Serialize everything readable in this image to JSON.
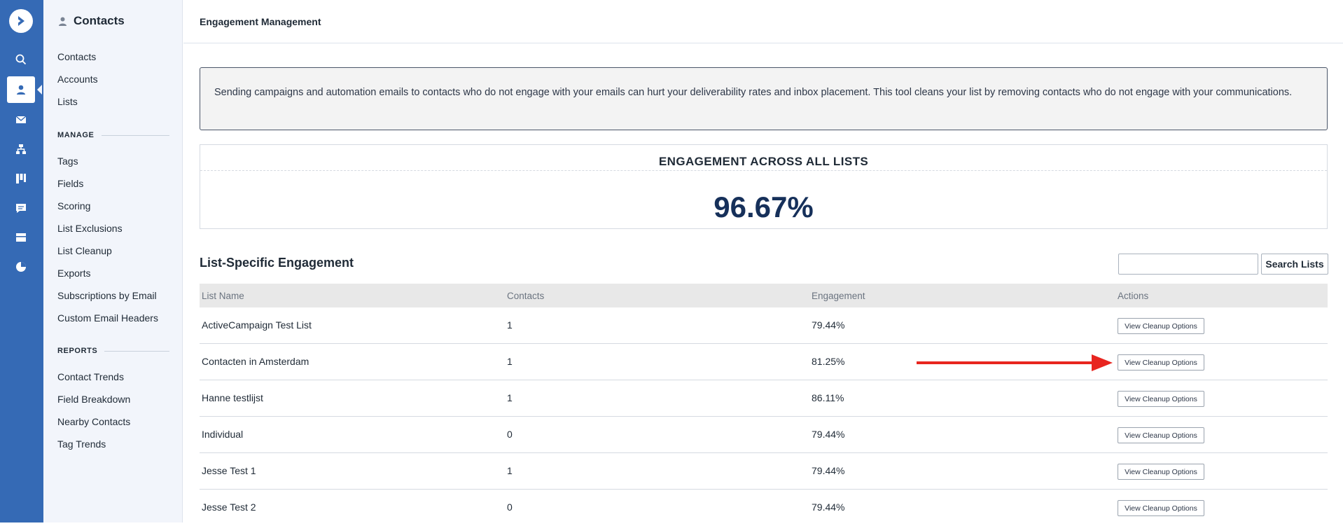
{
  "rail": {
    "items": [
      "search-icon",
      "contacts-icon",
      "campaigns-icon",
      "automations-icon",
      "deals-icon",
      "conversations-icon",
      "site-icon",
      "reports-icon"
    ],
    "active": "contacts-icon",
    "accent": "#356ab5"
  },
  "sidebar": {
    "title": "Contacts",
    "top_links": [
      "Contacts",
      "Accounts",
      "Lists"
    ],
    "manage_label": "MANAGE",
    "manage_links": [
      "Tags",
      "Fields",
      "Scoring",
      "List Exclusions",
      "List Cleanup",
      "Exports",
      "Subscriptions by Email",
      "Custom Email Headers"
    ],
    "reports_label": "REPORTS",
    "reports_links": [
      "Contact Trends",
      "Field Breakdown",
      "Nearby Contacts",
      "Tag Trends"
    ]
  },
  "header": {
    "title": "Engagement Management"
  },
  "notice": {
    "text": "Sending campaigns and automation emails to contacts who do not engage with your emails can hurt your deliverability rates and inbox placement. This tool cleans your list by removing contacts who do not engage with your communications."
  },
  "overall": {
    "title": "ENGAGEMENT ACROSS ALL LISTS",
    "value": "96.67%"
  },
  "lists": {
    "title": "List-Specific Engagement",
    "search_button": "Search Lists",
    "search_value": "",
    "columns": [
      "List Name",
      "Contacts",
      "Engagement",
      "Actions"
    ],
    "rows": [
      {
        "name": "ActiveCampaign Test List",
        "contacts": "1",
        "engagement": "79.44%",
        "action": "View Cleanup Options"
      },
      {
        "name": "Contacten in Amsterdam",
        "contacts": "1",
        "engagement": "81.25%",
        "action": "View Cleanup Options"
      },
      {
        "name": "Hanne testlijst",
        "contacts": "1",
        "engagement": "86.11%",
        "action": "View Cleanup Options"
      },
      {
        "name": "Individual",
        "contacts": "0",
        "engagement": "79.44%",
        "action": "View Cleanup Options"
      },
      {
        "name": "Jesse Test 1",
        "contacts": "1",
        "engagement": "79.44%",
        "action": "View Cleanup Options"
      },
      {
        "name": "Jesse Test 2",
        "contacts": "0",
        "engagement": "79.44%",
        "action": "View Cleanup Options"
      }
    ]
  },
  "annotation": {
    "arrow_color": "#e8251f",
    "points_to_row": 1
  }
}
